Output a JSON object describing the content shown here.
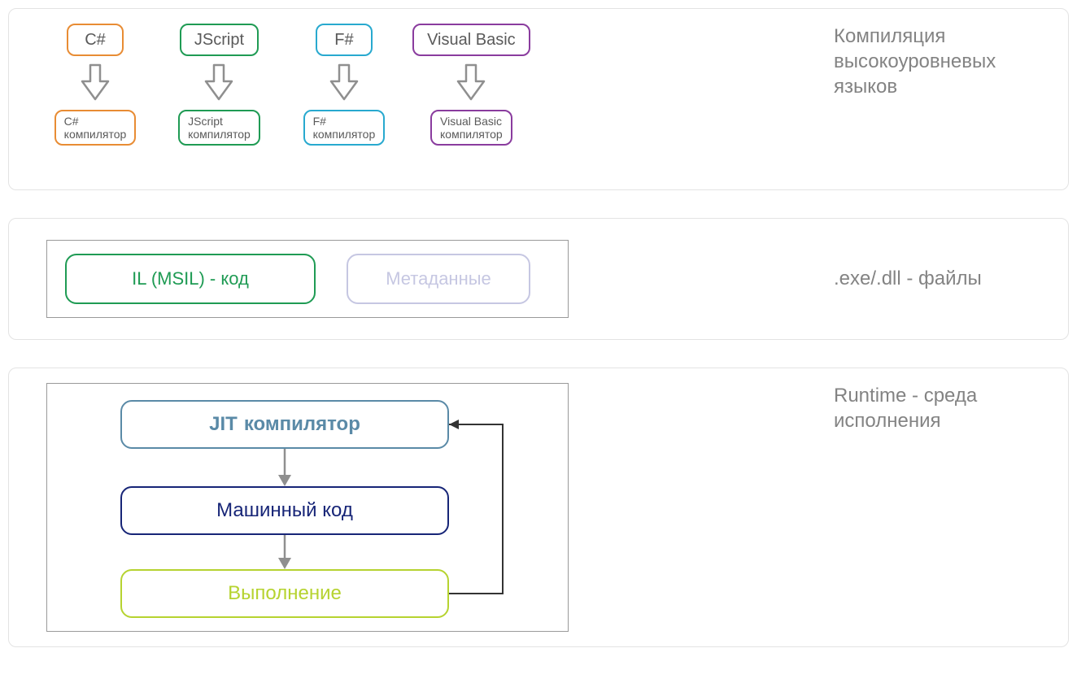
{
  "panel1": {
    "caption": "Компиляция высокоуровневых языков",
    "columns": [
      {
        "lang": "C#",
        "compiler": "C#\nкомпилятор",
        "color": "orange"
      },
      {
        "lang": "JScript",
        "compiler": "JScript\nкомпилятор",
        "color": "green"
      },
      {
        "lang": "F#",
        "compiler": "F#\nкомпилятор",
        "color": "cyan"
      },
      {
        "lang": "Visual Basic",
        "compiler": "Visual Basic\nкомпилятор",
        "color": "purple"
      }
    ]
  },
  "panel2": {
    "caption": ".exe/.dll - файлы",
    "il": "IL (MSIL) - код",
    "meta": "Метаданные"
  },
  "panel3": {
    "caption": "Runtime - среда исполнения",
    "jit_strong": "JIT",
    "jit_rest": "компилятор",
    "machine_code": "Машинный код",
    "execution": "Выполнение"
  },
  "colors": {
    "arrow_gray": "#8f8f8f"
  }
}
